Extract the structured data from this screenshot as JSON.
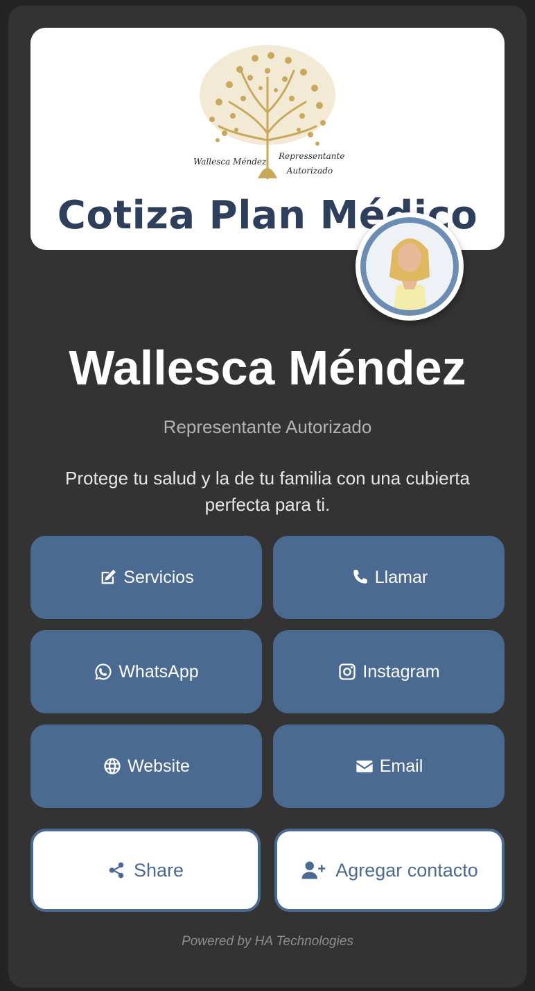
{
  "banner": {
    "logo_name": "Wallesca Méndez",
    "logo_title_line1": "Repressentante",
    "logo_title_line2": "Autorizado",
    "heading": "Cotiza Plan Médico"
  },
  "profile": {
    "name": "Wallesca Méndez",
    "role": "Representante Autorizado",
    "bio": "Protege tu salud y la de tu familia con una cubierta perfecta para ti."
  },
  "actions": {
    "servicios": "Servicios",
    "llamar": "Llamar",
    "whatsapp": "WhatsApp",
    "instagram": "Instagram",
    "website": "Website",
    "email": "Email",
    "share": "Share",
    "add_contact": "Agregar contacto"
  },
  "icons": {
    "servicios": "edit-icon",
    "llamar": "phone-icon",
    "whatsapp": "whatsapp-icon",
    "instagram": "instagram-icon",
    "website": "globe-icon",
    "email": "envelope-icon",
    "share": "share-icon",
    "add_contact": "user-plus-icon"
  },
  "footer": {
    "text": "Powered by HA Technologies"
  },
  "colors": {
    "background": "#242424",
    "card": "#333333",
    "accent": "#4b6a91",
    "heading": "#2e3f5c",
    "logo_gold": "#c8a85b"
  }
}
